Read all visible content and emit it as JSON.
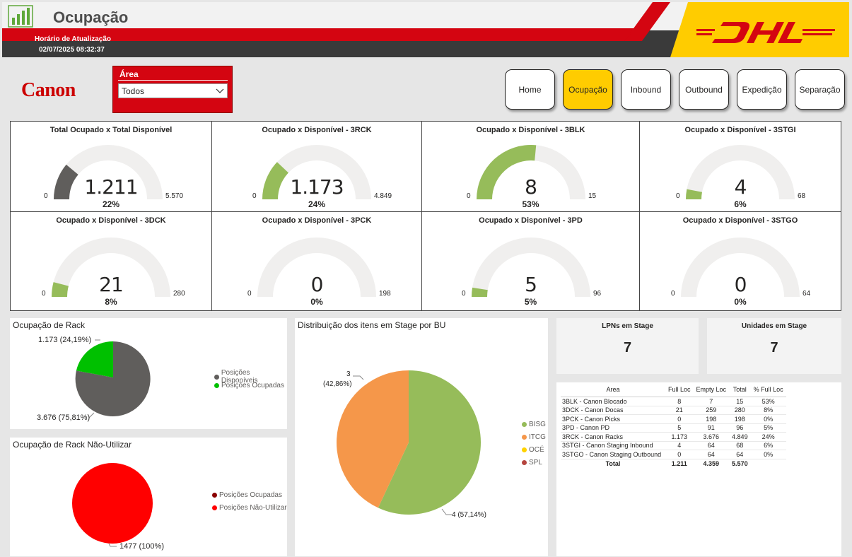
{
  "header": {
    "title": "Ocupação",
    "update_label": "Horário de Atualização",
    "update_time": "02/07/2025 08:32:37",
    "brand_logo": "DHL",
    "app_icon": "bar-chart-icon"
  },
  "client_logo": "Canon",
  "filter": {
    "label": "Área",
    "value": "Todos"
  },
  "nav": [
    "Home",
    "Ocupação",
    "Inbound",
    "Outbound",
    "Expedição",
    "Separação"
  ],
  "nav_active": "Ocupação",
  "gauges": [
    {
      "title": "Total Ocupado x Total Disponível",
      "value": "1.211",
      "pct": "22%",
      "min": "0",
      "max": "5.570",
      "fraction": 0.22,
      "color": "#605e5c"
    },
    {
      "title": "Ocupado x Disponível - 3RCK",
      "value": "1.173",
      "pct": "24%",
      "min": "0",
      "max": "4.849",
      "fraction": 0.24,
      "color": "#96bc5a"
    },
    {
      "title": "Ocupado x Disponível - 3BLK",
      "value": "8",
      "pct": "53%",
      "min": "0",
      "max": "15",
      "fraction": 0.53,
      "color": "#96bc5a"
    },
    {
      "title": "Ocupado x Disponível - 3STGI",
      "value": "4",
      "pct": "6%",
      "min": "0",
      "max": "68",
      "fraction": 0.06,
      "color": "#96bc5a"
    },
    {
      "title": "Ocupado x Disponível - 3DCK",
      "value": "21",
      "pct": "8%",
      "min": "0",
      "max": "280",
      "fraction": 0.08,
      "color": "#96bc5a"
    },
    {
      "title": "Ocupado x Disponível - 3PCK",
      "value": "0",
      "pct": "0%",
      "min": "0",
      "max": "198",
      "fraction": 0,
      "color": "#96bc5a"
    },
    {
      "title": "Ocupado x Disponível - 3PD",
      "value": "5",
      "pct": "5%",
      "min": "0",
      "max": "96",
      "fraction": 0.05,
      "color": "#96bc5a"
    },
    {
      "title": "Ocupado x Disponível - 3STGO",
      "value": "0",
      "pct": "0%",
      "min": "0",
      "max": "64",
      "fraction": 0,
      "color": "#96bc5a"
    }
  ],
  "rack": {
    "title": "Ocupação de Rack",
    "label_occupied": "1.173 (24,19%)",
    "label_available": "3.676 (75,81%)",
    "legend": [
      {
        "label": "Posições Disponíveis",
        "color": "#605e5c"
      },
      {
        "label": "Posições Ocupadas",
        "color": "#00c000"
      }
    ]
  },
  "rack_nu": {
    "title": "Ocupação de Rack Não-Utilizar",
    "label": "1477 (100%)",
    "legend": [
      {
        "label": "Posições Ocupadas",
        "color": "#8b0000"
      },
      {
        "label": "Posições Não-Utilizar",
        "color": "#ff0000"
      }
    ]
  },
  "stage": {
    "title": "Distribuição dos itens em Stage por BU",
    "label_itcg_value": "3",
    "label_itcg_pct": "(42,86%)",
    "label_bisg": "4 (57,14%)",
    "legend": [
      {
        "label": "BISG",
        "color": "#96bc5a"
      },
      {
        "label": "ITCG",
        "color": "#f5974a"
      },
      {
        "label": "OCÉ",
        "color": "#ffd200"
      },
      {
        "label": "SPL",
        "color": "#b5453f"
      }
    ]
  },
  "cards": [
    {
      "title": "LPNs em Stage",
      "value": "7"
    },
    {
      "title": "Unidades em Stage",
      "value": "7"
    }
  ],
  "table": {
    "headers": [
      "Area",
      "Full Loc",
      "Empty Loc",
      "Total",
      "% Full Loc"
    ],
    "rows": [
      [
        "3BLK - Canon Blocado",
        "8",
        "7",
        "15",
        "53%"
      ],
      [
        "3DCK - Canon Docas",
        "21",
        "259",
        "280",
        "8%"
      ],
      [
        "3PCK - Canon Picks",
        "0",
        "198",
        "198",
        "0%"
      ],
      [
        "3PD - Canon PD",
        "5",
        "91",
        "96",
        "5%"
      ],
      [
        "3RCK - Canon Racks",
        "1.173",
        "3.676",
        "4.849",
        "24%"
      ],
      [
        "3STGI - Canon Staging Inbound",
        "4",
        "64",
        "68",
        "6%"
      ],
      [
        "3STGO - Canon Staging Outbound",
        "0",
        "64",
        "64",
        "0%"
      ]
    ],
    "total": [
      "Total",
      "1.211",
      "4.359",
      "5.570",
      ""
    ]
  },
  "chart_data": [
    {
      "type": "pie",
      "title": "Ocupação de Rack",
      "categories": [
        "Posições Disponíveis",
        "Posições Ocupadas"
      ],
      "values": [
        3676,
        1173
      ]
    },
    {
      "type": "pie",
      "title": "Ocupação de Rack Não-Utilizar",
      "categories": [
        "Posições Ocupadas",
        "Posições Não-Utilizar"
      ],
      "values": [
        0,
        1477
      ]
    },
    {
      "type": "pie",
      "title": "Distribuição dos itens em Stage por BU",
      "categories": [
        "BISG",
        "ITCG",
        "OCÉ",
        "SPL"
      ],
      "values": [
        4,
        3,
        0,
        0
      ]
    }
  ]
}
